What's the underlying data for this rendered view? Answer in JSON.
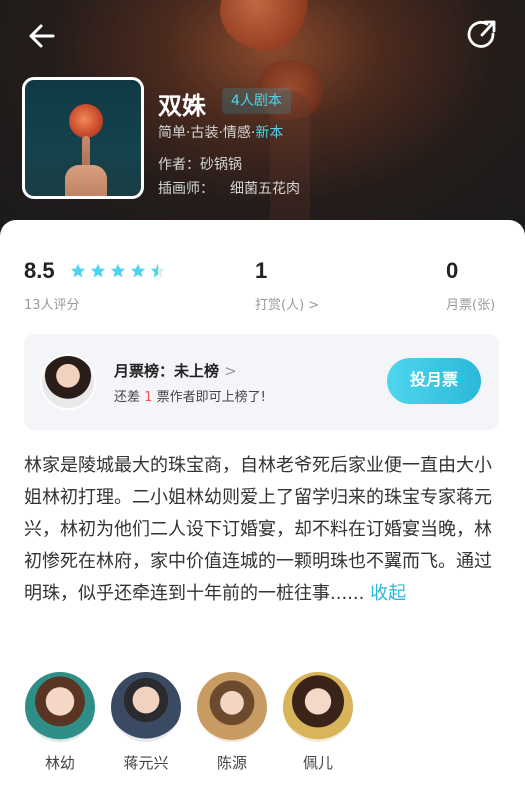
{
  "book": {
    "title": "双姝",
    "badge": "4人剧本",
    "tags": "简单·古装·情感·",
    "tag_new": "新本",
    "author": "作者：砂锅锅",
    "illustrator_label": "插画师：",
    "illustrator": "细菌五花肉"
  },
  "stats": {
    "rating": "8.5",
    "rating_stars": 4.5,
    "rating_label": "13人评分",
    "tips": "1",
    "tips_label": "打赏(人) >",
    "tickets": "0",
    "tickets_label": "月票(张)"
  },
  "rank": {
    "title": "月票榜：未上榜",
    "arrow": ">",
    "sub_prefix": "还差",
    "sub_count": "1",
    "sub_suffix": "票作者即可上榜了!",
    "vote_label": "投月票"
  },
  "description": {
    "text": "林家是陵城最大的珠宝商，自林老爷死后家业便一直由大小姐林初打理。二小姐林幼则爱上了留学归来的珠宝专家蒋元兴，林初为他们二人设下订婚宴，却不料在订婚宴当晚，林初惨死在林府，家中价值连城的一颗明珠也不翼而飞。通过明珠，似乎还牵连到十年前的一桩往事......",
    "collapse_label": "收起"
  },
  "characters": [
    {
      "name": "林幼"
    },
    {
      "name": "蒋元兴"
    },
    {
      "name": "陈源"
    },
    {
      "name": "佩儿"
    }
  ],
  "colors": {
    "accent": "#2bb8da",
    "star": "#4fd3ee",
    "highlight_red": "#f2555a"
  }
}
